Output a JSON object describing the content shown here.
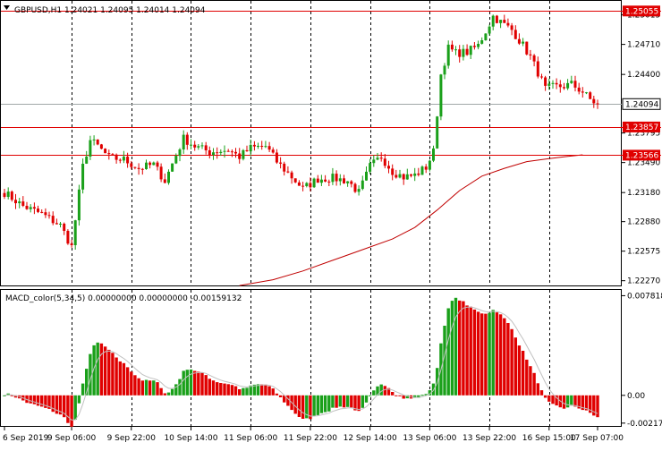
{
  "header": {
    "symbol_text": "GBPUSD,H1  1.24021 1.24095 1.24014 1.24094",
    "indicator_text": "MACD_color(5,34,5) 0.00000000 0.00000000 -0.00159132"
  },
  "colors": {
    "bull": "#1aa01a",
    "bear": "#e00000",
    "level_line": "#e00000",
    "ma_line": "#c00000",
    "current_price_line": "#a0a8a8",
    "grid": "#000000",
    "frame": "#000000"
  },
  "icons": {
    "collapse": "triangle-down-icon"
  },
  "chart_data": [
    {
      "type": "candlestick",
      "title": "GBPUSD,H1",
      "ylim": [
        1.2223,
        1.2515
      ],
      "price_ticks": [
        "1.25015",
        "1.24710",
        "1.24400",
        "1.23795",
        "1.23490",
        "1.23180",
        "1.22880",
        "1.22575",
        "1.22270"
      ],
      "levels": [
        {
          "value": 1.25055,
          "label": "1.25055"
        },
        {
          "value": 1.23857,
          "label": "1.23857"
        },
        {
          "value": 1.23566,
          "label": "1.23566"
        }
      ],
      "current_price": {
        "value": 1.24094,
        "label": "1.24094"
      },
      "x_labels": [
        "6 Sep 2019",
        "9 Sep 06:00",
        "9 Sep 22:00",
        "10 Sep 14:00",
        "11 Sep 06:00",
        "11 Sep 22:00",
        "12 Sep 14:00",
        "13 Sep 06:00",
        "13 Sep 22:00",
        "16 Sep 15:00",
        "17 Sep 07:00"
      ],
      "anchors": [
        [
          0,
          1.2318
        ],
        [
          5,
          1.2304
        ],
        [
          10,
          1.2296
        ],
        [
          15,
          1.2284
        ],
        [
          18,
          1.2262
        ],
        [
          21,
          1.2345
        ],
        [
          23,
          1.2372
        ],
        [
          25,
          1.2366
        ],
        [
          28,
          1.2354
        ],
        [
          32,
          1.2352
        ],
        [
          36,
          1.2343
        ],
        [
          40,
          1.2347
        ],
        [
          43,
          1.233
        ],
        [
          45,
          1.2348
        ],
        [
          48,
          1.2374
        ],
        [
          51,
          1.2366
        ],
        [
          55,
          1.236
        ],
        [
          60,
          1.2362
        ],
        [
          63,
          1.2355
        ],
        [
          66,
          1.2364
        ],
        [
          70,
          1.2366
        ],
        [
          73,
          1.235
        ],
        [
          77,
          1.2334
        ],
        [
          80,
          1.2322
        ],
        [
          84,
          1.2332
        ],
        [
          88,
          1.2333
        ],
        [
          92,
          1.233
        ],
        [
          95,
          1.2318
        ],
        [
          98,
          1.2345
        ],
        [
          101,
          1.2355
        ],
        [
          104,
          1.234
        ],
        [
          107,
          1.2334
        ],
        [
          110,
          1.2336
        ],
        [
          113,
          1.2344
        ],
        [
          115,
          1.236
        ],
        [
          117,
          1.244
        ],
        [
          119,
          1.2467
        ],
        [
          121,
          1.2462
        ],
        [
          124,
          1.2463
        ],
        [
          127,
          1.247
        ],
        [
          130,
          1.2492
        ],
        [
          131,
          1.25
        ],
        [
          133,
          1.2494
        ],
        [
          136,
          1.2486
        ],
        [
          139,
          1.247
        ],
        [
          141,
          1.2458
        ],
        [
          143,
          1.2442
        ],
        [
          145,
          1.2425
        ],
        [
          147,
          1.2427
        ],
        [
          150,
          1.2428
        ],
        [
          152,
          1.243
        ],
        [
          155,
          1.2422
        ],
        [
          157,
          1.2414
        ],
        [
          159,
          1.2409
        ]
      ],
      "moving_average": [
        [
          63,
          1.2222
        ],
        [
          72,
          1.2228
        ],
        [
          80,
          1.2237
        ],
        [
          88,
          1.2248
        ],
        [
          96,
          1.2259
        ],
        [
          104,
          1.227
        ],
        [
          110,
          1.2282
        ],
        [
          116,
          1.23
        ],
        [
          122,
          1.232
        ],
        [
          128,
          1.2335
        ],
        [
          134,
          1.2343
        ],
        [
          140,
          1.235
        ],
        [
          146,
          1.2353
        ],
        [
          150,
          1.2355
        ],
        [
          155,
          1.2357
        ]
      ]
    },
    {
      "type": "bar",
      "title": "MACD_color(5,34,5)",
      "ylim": [
        -0.0024,
        0.0082
      ],
      "y_ticks": [
        {
          "value": 0.0078185,
          "label": "0.0078185"
        },
        {
          "value": 0.0,
          "label": "0.00"
        },
        {
          "value": -0.002179,
          "label": "-0.002179"
        }
      ]
    }
  ]
}
